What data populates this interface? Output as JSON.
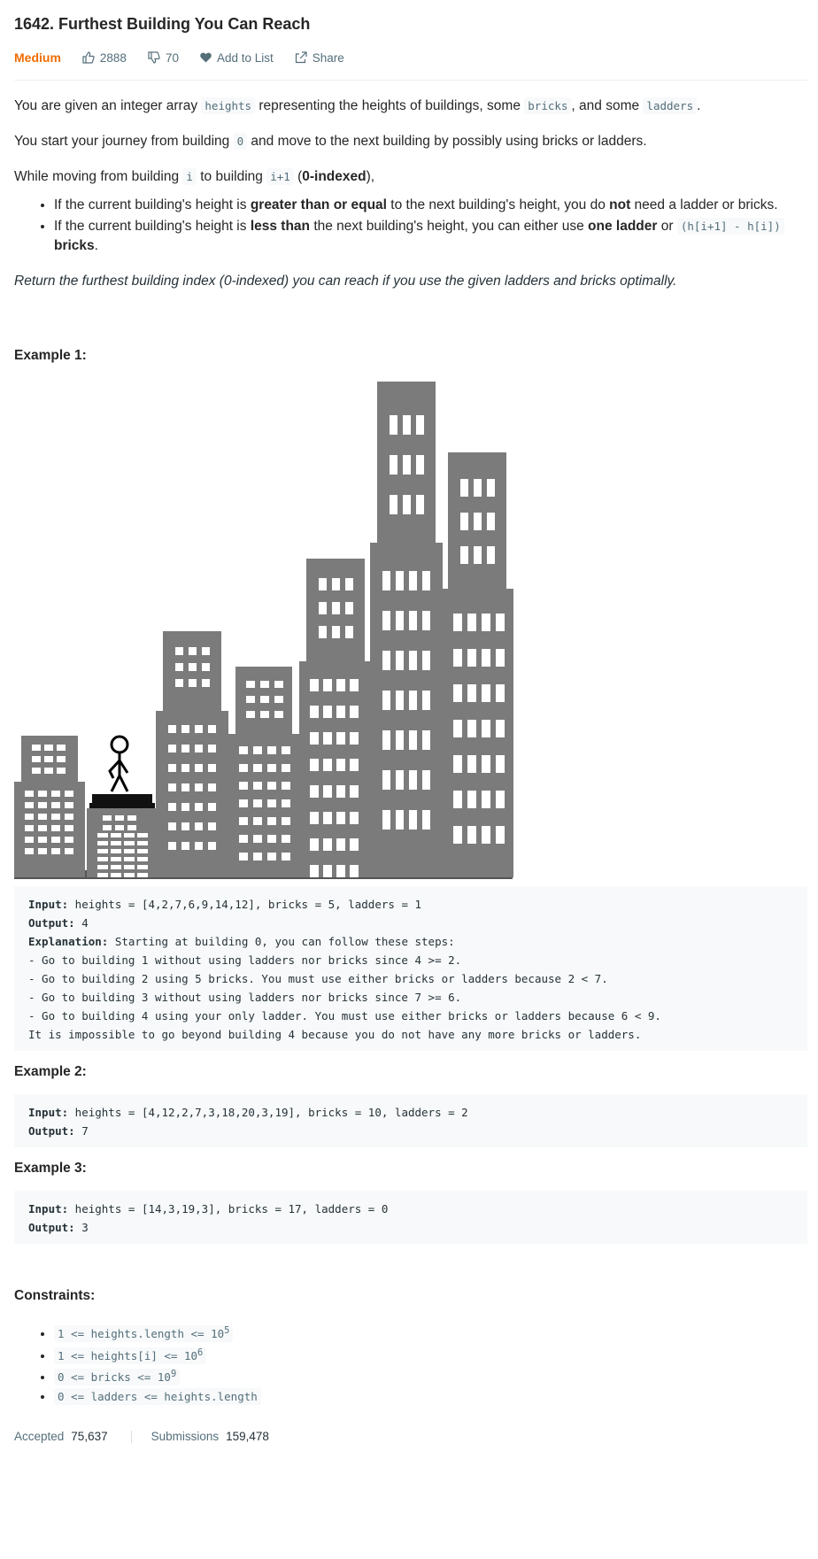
{
  "problem": {
    "title": "1642. Furthest Building You Can Reach",
    "difficulty": "Medium",
    "likes": "2888",
    "dislikes": "70",
    "add_to_list": "Add to List",
    "share": "Share"
  },
  "description": {
    "p1": {
      "a": "You are given an integer array ",
      "c1": "heights",
      "b": " representing the heights of buildings, some ",
      "c2": "bricks",
      "c": ", and some ",
      "c3": "ladders",
      "d": "."
    },
    "p2": {
      "a": "You start your journey from building ",
      "c1": "0",
      "b": " and move to the next building by possibly using bricks or ladders."
    },
    "p3": {
      "a": "While moving from building ",
      "c1": "i",
      "b": " to building ",
      "c2": "i+1",
      "c": " (",
      "bold": "0-indexed",
      "d": "),"
    },
    "rule1": {
      "a": "If the current building's height is ",
      "b1": "greater than or equal",
      "b": " to the next building's height, you do ",
      "b2": "not",
      "c": " need a ladder or bricks."
    },
    "rule2": {
      "a": "If the current building's height is ",
      "b1": "less than",
      "b": " the next building's height, you can either use ",
      "b2": "one ladder",
      "c": " or ",
      "c1": "(h[i+1] - h[i])",
      "b3": "bricks",
      "d": "."
    },
    "goal": "Return the furthest building index (0-indexed) you can reach if you use the given ladders and bricks optimally."
  },
  "examples": [
    {
      "title": "Example 1:",
      "input_label": "Input:",
      "input": " heights = [4,2,7,6,9,14,12], bricks = 5, ladders = 1",
      "output_label": "Output:",
      "output": " 4",
      "explanation_label": "Explanation:",
      "explanation": " Starting at building 0, you can follow these steps:",
      "steps": [
        "- Go to building 1 without using ladders nor bricks since 4 >= 2.",
        "- Go to building 2 using 5 bricks. You must use either bricks or ladders because 2 < 7.",
        "- Go to building 3 without using ladders nor bricks since 7 >= 6.",
        "- Go to building 4 using your only ladder. You must use either bricks or ladders because 6 < 9.",
        "It is impossible to go beyond building 4 because you do not have any more bricks or ladders."
      ]
    },
    {
      "title": "Example 2:",
      "input_label": "Input:",
      "input": " heights = [4,12,2,7,3,18,20,3,19], bricks = 10, ladders = 2",
      "output_label": "Output:",
      "output": " 7"
    },
    {
      "title": "Example 3:",
      "input_label": "Input:",
      "input": " heights = [14,3,19,3], bricks = 17, ladders = 0",
      "output_label": "Output:",
      "output": " 3"
    }
  ],
  "constraints": {
    "title": "Constraints:",
    "items": [
      {
        "text": "1 <= heights.length <= 10",
        "sup": "5"
      },
      {
        "text": "1 <= heights[i] <= 10",
        "sup": "6"
      },
      {
        "text": "0 <= bricks <= 10",
        "sup": "9"
      },
      {
        "text": "0 <= ladders <= heights.length",
        "sup": ""
      }
    ]
  },
  "stats": {
    "accepted_label": "Accepted",
    "accepted": "75,637",
    "submissions_label": "Submissions",
    "submissions": "159,478"
  },
  "colors": {
    "accent": "#ef6c00",
    "building": "#7b7b7b",
    "window": "#ffffff",
    "code_bg": "#f7f9fa"
  }
}
